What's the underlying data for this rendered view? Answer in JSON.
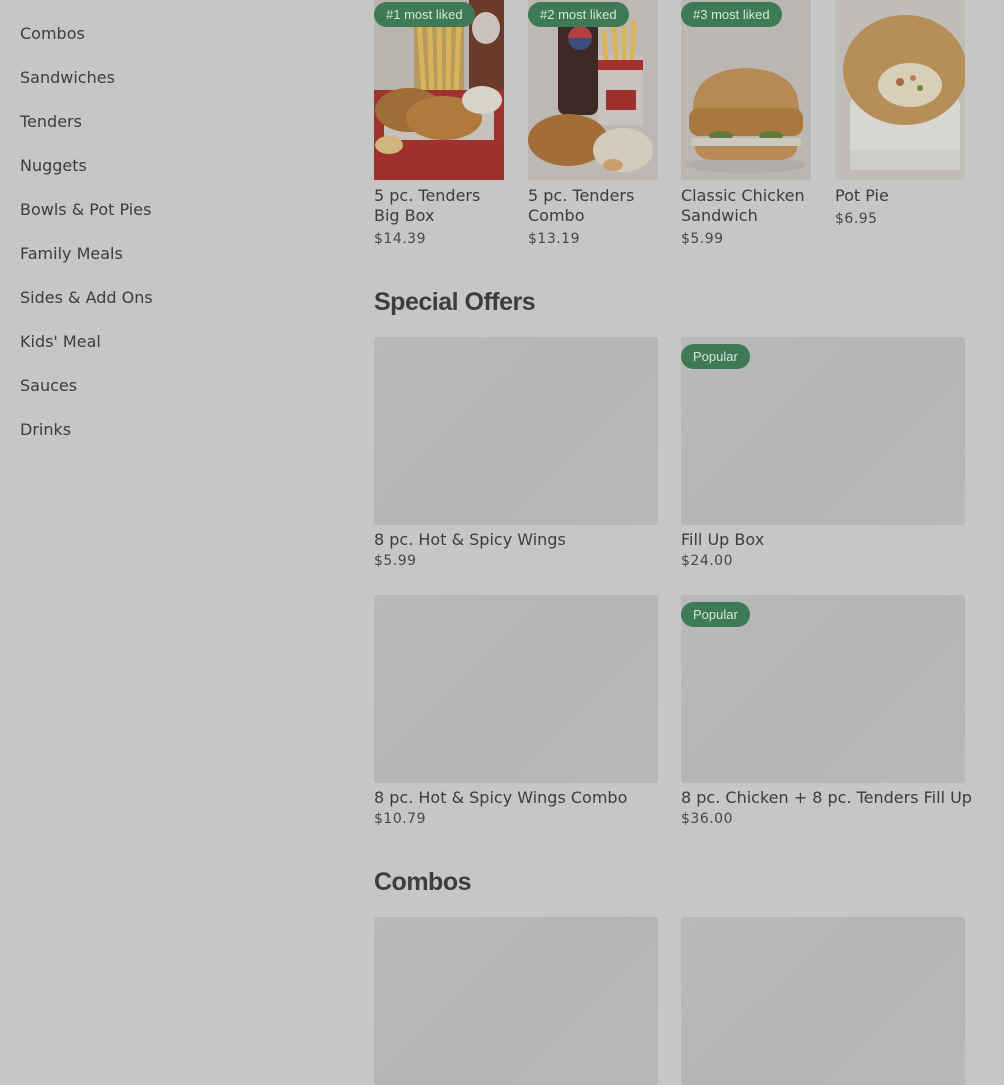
{
  "sidebar": {
    "items": [
      {
        "label": "Combos"
      },
      {
        "label": "Sandwiches"
      },
      {
        "label": "Tenders"
      },
      {
        "label": "Nuggets"
      },
      {
        "label": "Bowls & Pot Pies"
      },
      {
        "label": "Family Meals"
      },
      {
        "label": "Sides & Add Ons"
      },
      {
        "label": "Kids' Meal"
      },
      {
        "label": "Sauces"
      },
      {
        "label": "Drinks"
      }
    ]
  },
  "most_liked": {
    "items": [
      {
        "badge": "#1 most liked",
        "name": "5 pc. Tenders Big Box",
        "price": "$14.39"
      },
      {
        "badge": "#2 most liked",
        "name": "5 pc. Tenders Combo",
        "price": "$13.19"
      },
      {
        "badge": "#3 most liked",
        "name": "Classic Chicken Sandwich",
        "price": "$5.99"
      },
      {
        "badge": "",
        "name": "Pot Pie",
        "price": "$6.95"
      }
    ]
  },
  "special_offers": {
    "title": "Special Offers",
    "items": [
      {
        "badge": "",
        "name": "8 pc. Hot & Spicy Wings",
        "price": "$5.99"
      },
      {
        "badge": "Popular",
        "name": "Fill Up Box",
        "price": "$24.00"
      },
      {
        "badge": "",
        "name": "8 pc. Hot & Spicy Wings Combo",
        "price": "$10.79"
      },
      {
        "badge": "Popular",
        "name": "8 pc. Chicken + 8 pc. Tenders Fill Up",
        "price": "$36.00"
      }
    ]
  },
  "combos": {
    "title": "Combos"
  },
  "colors": {
    "background": "#c6c6c6",
    "badge": "#3e7a56",
    "placeholder": "#b6b6b6"
  }
}
